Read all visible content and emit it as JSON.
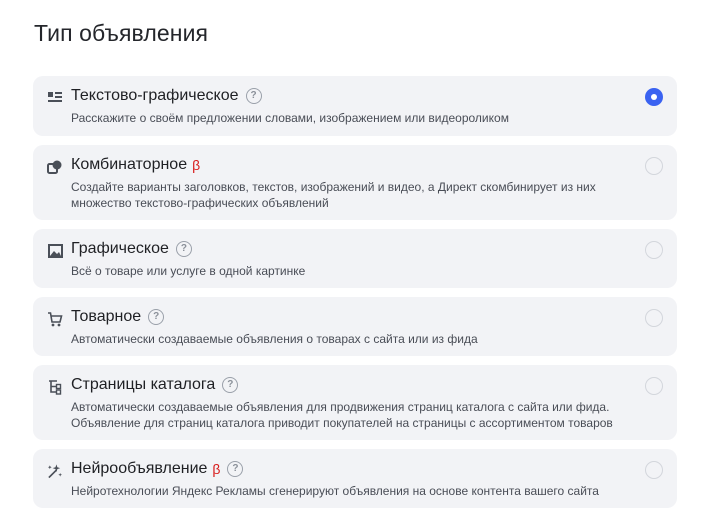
{
  "page": {
    "title": "Тип объявления"
  },
  "options": [
    {
      "name": "Текстово-графическое",
      "beta": "",
      "desc": "Расскажите о своём предложении словами, изображением или видеороликом",
      "icon": "text-graphic-icon",
      "selected": true
    },
    {
      "name": "Комбинаторное",
      "beta": "β",
      "desc": "Создайте варианты заголовков, текстов, изображений и видео, а Директ скомбинирует из них множество текстово-графических объявлений",
      "icon": "combinatorial-icon",
      "selected": false
    },
    {
      "name": "Графическое",
      "beta": "",
      "desc": "Всё о товаре или услуге в одной картинке",
      "icon": "image-icon",
      "selected": false
    },
    {
      "name": "Товарное",
      "beta": "",
      "desc": "Автоматически создаваемые объявления о товарах с сайта или из фида",
      "icon": "cart-icon",
      "selected": false
    },
    {
      "name": "Страницы каталога",
      "beta": "",
      "desc": "Автоматически создаваемые объявления для продвижения страниц каталога с сайта или фида. Объявление для страниц каталога приводит покупателей на страницы с ассортиментом товаров",
      "icon": "catalog-tree-icon",
      "selected": false
    },
    {
      "name": "Нейрообъявление",
      "beta": "β",
      "desc": "Нейротехнологии Яндекс Рекламы сгенерируют объявления на основе контента вашего сайта",
      "icon": "magic-wand-icon",
      "selected": false
    }
  ],
  "help_glyph": "?",
  "colors": {
    "accent": "#3a62f1",
    "beta": "#d81d1d",
    "card_bg": "#f2f3f6"
  }
}
